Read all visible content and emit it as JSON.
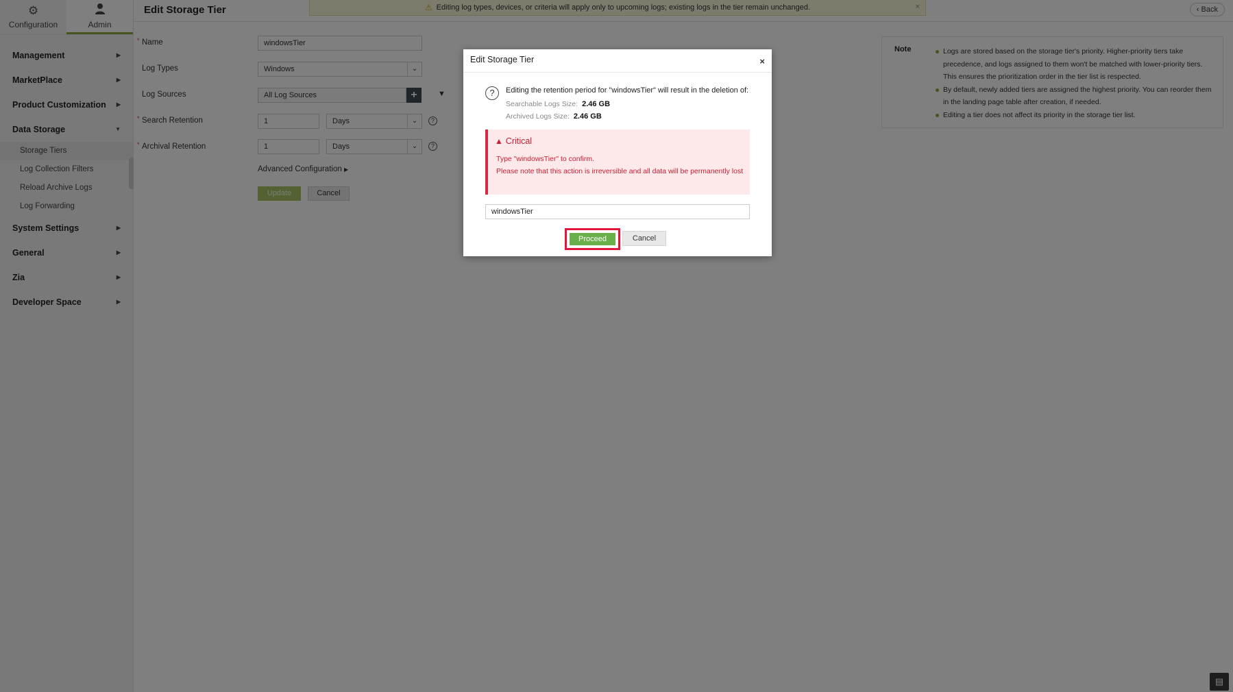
{
  "top_tabs": [
    {
      "label": "Configuration",
      "icon": "gear-icon"
    },
    {
      "label": "Admin",
      "icon": "user-icon"
    }
  ],
  "sidebar": {
    "items": [
      {
        "label": "Management"
      },
      {
        "label": "MarketPlace"
      },
      {
        "label": "Product Customization"
      },
      {
        "label": "Data Storage"
      }
    ],
    "sub_items": [
      {
        "label": "Storage Tiers"
      },
      {
        "label": "Log Collection Filters"
      },
      {
        "label": "Reload Archive Logs"
      },
      {
        "label": "Log Forwarding"
      }
    ],
    "items_after": [
      {
        "label": "System Settings"
      },
      {
        "label": "General"
      },
      {
        "label": "Zia"
      },
      {
        "label": "Developer Space"
      }
    ]
  },
  "header": {
    "title": "Edit Storage Tier",
    "banner": "Editing log types, devices, or criteria will apply only to upcoming logs; existing logs in the tier remain unchanged.",
    "back_label": "Back"
  },
  "form": {
    "name_label": "Name",
    "name_value": "windowsTier",
    "log_types_label": "Log Types",
    "log_types_value": "Windows",
    "log_sources_label": "Log Sources",
    "log_sources_value": "All Log Sources",
    "search_retention_label": "Search Retention",
    "search_retention_value": "1",
    "search_retention_unit": "Days",
    "archival_retention_label": "Archival Retention",
    "archival_retention_value": "1",
    "archival_retention_unit": "Days",
    "advanced_label": "Advanced Configuration",
    "update_label": "Update",
    "cancel_label": "Cancel"
  },
  "note": {
    "title": "Note",
    "items": [
      "Logs are stored based on the storage tier's priority. Higher-priority tiers take precedence, and logs assigned to them won't be matched with lower-priority tiers. This ensures the prioritization order in the tier list is respected.",
      "By default, newly added tiers are assigned the highest priority. You can reorder them in the landing page table after creation, if needed.",
      "Editing a tier does not affect its priority in the storage tier list."
    ]
  },
  "modal": {
    "title": "Edit Storage Tier",
    "close": "×",
    "message": "Editing the retention period for \"windowsTier\" will result in the deletion of:",
    "searchable_label": "Searchable Logs Size:",
    "searchable_value": "2.46 GB",
    "archived_label": "Archived Logs Size:",
    "archived_value": "2.46 GB",
    "critical_title": "Critical",
    "critical_line1": "Type \"windowsTier\" to confirm.",
    "critical_line2": "Please note that this action is irreversible and all data will be permanently lost",
    "confirm_value": "windowsTier",
    "proceed_label": "Proceed",
    "cancel_label": "Cancel"
  },
  "colors": {
    "accent": "#8aa63d",
    "critical": "#c71f33",
    "proceed": "#6ab04a",
    "highlight": "#e0163a"
  }
}
